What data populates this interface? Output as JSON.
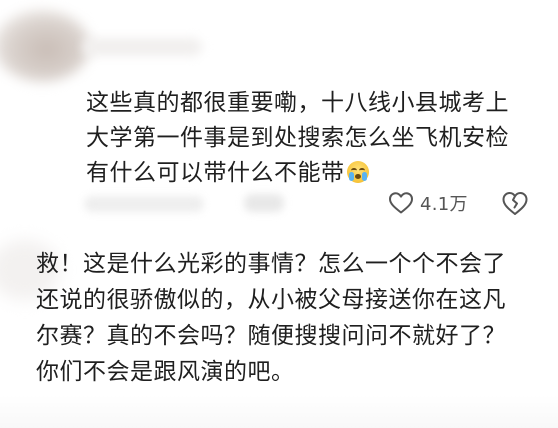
{
  "comments": [
    {
      "lines": [
        "这些真的都很重要嘞，十八线小县城考上",
        "大学第一件事是到处搜索怎么坐飞机安检",
        "有什么可以带什么不能带"
      ],
      "emoji": "crying-face-emoji",
      "like_count": "4.1万",
      "like_icon": "heart-outline-icon",
      "dislike_icon": "broken-heart-icon"
    },
    {
      "lines": [
        "救！这是什么光彩的事情？怎么一个个不会了",
        "还说的很骄傲似的，从小被父母接送你在这凡",
        "尔赛？真的不会吗？随便搜搜问问不就好了？",
        "你们不会是跟风演的吧。"
      ]
    }
  ],
  "colors": {
    "text": "#1f1f1f",
    "meta_text": "#555555",
    "icon_stroke": "#555555",
    "background": "#ffffff"
  }
}
